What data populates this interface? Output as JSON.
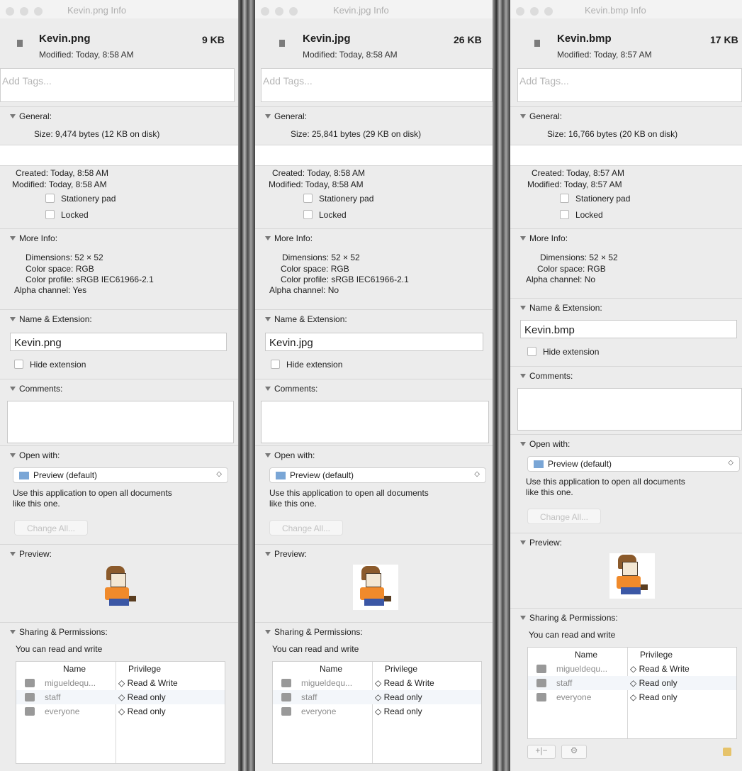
{
  "panels": [
    {
      "window_title": "Kevin.png Info",
      "file_name": "Kevin.png",
      "file_size": "9 KB",
      "modified_header": "Modified: Today, 8:58 AM",
      "tags_placeholder": "Add Tags...",
      "general": {
        "label": "General:",
        "size": "Size: 9,474 bytes (12 KB on disk)",
        "created": "Created: Today, 8:58 AM",
        "modified": "Modified: Today, 8:58 AM",
        "stationery": "Stationery pad",
        "locked": "Locked"
      },
      "more_info": {
        "label": "More Info:",
        "dimensions": "Dimensions: 52 × 52",
        "color_space": "Color space: RGB",
        "color_profile": "Color profile: sRGB IEC61966-2.1",
        "alpha": "Alpha channel: Yes"
      },
      "name_ext": {
        "label": "Name & Extension:",
        "value": "Kevin.png",
        "hide": "Hide extension"
      },
      "comments_label": "Comments:",
      "open_with": {
        "label": "Open with:",
        "app": "Preview (default)",
        "desc1": "Use this application to open all documents",
        "desc2": "like this one.",
        "change_all": "Change All..."
      },
      "preview_label": "Preview:",
      "sharing": {
        "label": "Sharing & Permissions:",
        "summary": "You can read and write",
        "col_name": "Name",
        "col_privilege": "Privilege",
        "rows": [
          {
            "name": "migueldequ...",
            "privilege": "◇ Read & Write"
          },
          {
            "name": "staff",
            "privilege": "◇ Read only"
          },
          {
            "name": "everyone",
            "privilege": "◇ Read only"
          }
        ]
      }
    },
    {
      "window_title": "Kevin.jpg Info",
      "file_name": "Kevin.jpg",
      "file_size": "26 KB",
      "modified_header": "Modified: Today, 8:58 AM",
      "tags_placeholder": "Add Tags...",
      "general": {
        "label": "General:",
        "size": "Size: 25,841 bytes (29 KB on disk)",
        "created": "Created: Today, 8:58 AM",
        "modified": "Modified: Today, 8:58 AM",
        "stationery": "Stationery pad",
        "locked": "Locked"
      },
      "more_info": {
        "label": "More Info:",
        "dimensions": "Dimensions: 52 × 52",
        "color_space": "Color space: RGB",
        "color_profile": "Color profile: sRGB IEC61966-2.1",
        "alpha": "Alpha channel: No"
      },
      "name_ext": {
        "label": "Name & Extension:",
        "value": "Kevin.jpg",
        "hide": "Hide extension"
      },
      "comments_label": "Comments:",
      "open_with": {
        "label": "Open with:",
        "app": "Preview (default)",
        "desc1": "Use this application to open all documents",
        "desc2": "like this one.",
        "change_all": "Change All..."
      },
      "preview_label": "Preview:",
      "sharing": {
        "label": "Sharing & Permissions:",
        "summary": "You can read and write",
        "col_name": "Name",
        "col_privilege": "Privilege",
        "rows": [
          {
            "name": "migueldequ...",
            "privilege": "◇ Read & Write"
          },
          {
            "name": "staff",
            "privilege": "◇ Read only"
          },
          {
            "name": "everyone",
            "privilege": "◇ Read only"
          }
        ]
      }
    },
    {
      "window_title": "Kevin.bmp Info",
      "file_name": "Kevin.bmp",
      "file_size": "17 KB",
      "modified_header": "Modified: Today, 8:57 AM",
      "tags_placeholder": "Add Tags...",
      "general": {
        "label": "General:",
        "size": "Size: 16,766 bytes (20 KB on disk)",
        "created": "Created: Today, 8:57 AM",
        "modified": "Modified: Today, 8:57 AM",
        "stationery": "Stationery pad",
        "locked": "Locked"
      },
      "more_info": {
        "label": "More Info:",
        "dimensions": "Dimensions: 52 × 52",
        "color_space": "Color space: RGB",
        "alpha": "Alpha channel: No"
      },
      "name_ext": {
        "label": "Name & Extension:",
        "value": "Kevin.bmp",
        "hide": "Hide extension"
      },
      "comments_label": "Comments:",
      "open_with": {
        "label": "Open with:",
        "app": "Preview (default)",
        "desc1": "Use this application to open all documents",
        "desc2": "like this one.",
        "change_all": "Change All..."
      },
      "preview_label": "Preview:",
      "sharing": {
        "label": "Sharing & Permissions:",
        "summary": "You can read and write",
        "col_name": "Name",
        "col_privilege": "Privilege",
        "rows": [
          {
            "name": "migueldequ...",
            "privilege": "◇ Read & Write"
          },
          {
            "name": "staff",
            "privilege": "◇ Read only"
          },
          {
            "name": "everyone",
            "privilege": "◇ Read only"
          }
        ]
      }
    }
  ]
}
